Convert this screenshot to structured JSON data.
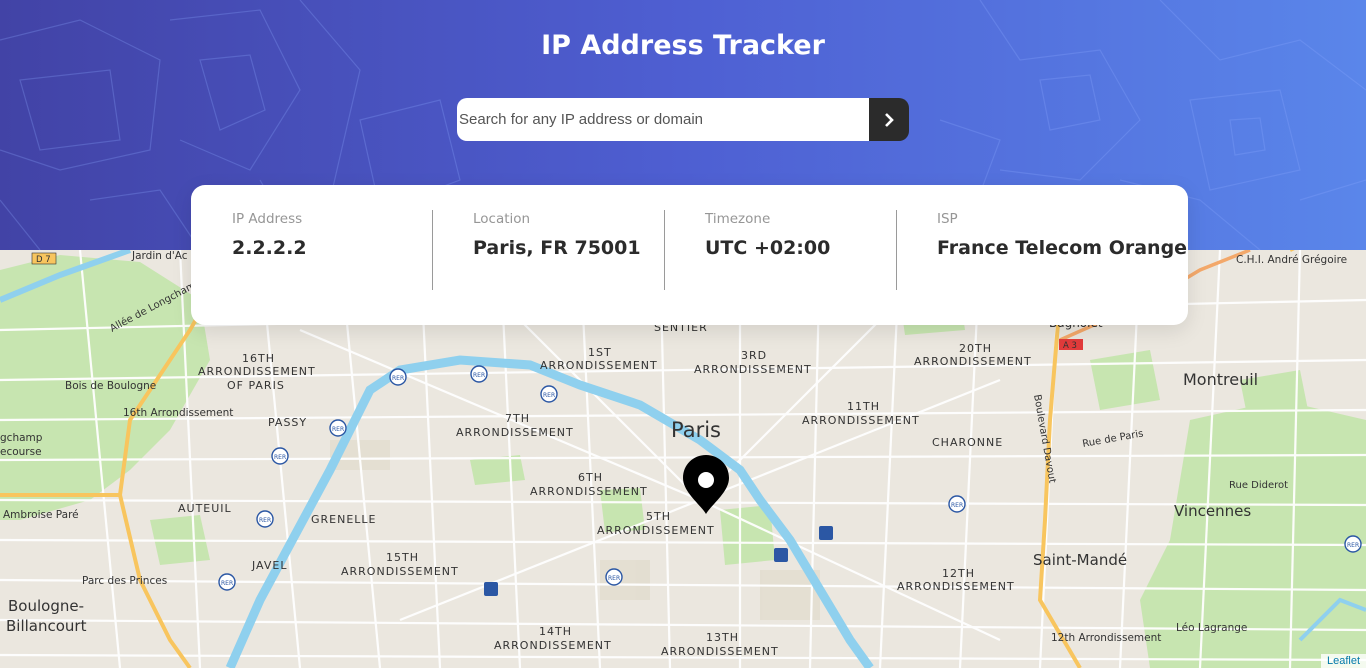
{
  "header": {
    "title": "IP Address Tracker",
    "search_placeholder": "Search for any IP address or domain",
    "search_value": "",
    "gradient_start": "#4243a6",
    "gradient_end": "#5a86ea",
    "button_icon": "chevron-right-icon"
  },
  "info": {
    "ip": {
      "label": "IP Address",
      "value": "2.2.2.2"
    },
    "location": {
      "label": "Location",
      "value": "Paris, FR 75001"
    },
    "timezone": {
      "label": "Timezone",
      "value": "UTC +02:00"
    },
    "isp": {
      "label": "ISP",
      "value": "France Telecom Orange"
    }
  },
  "map": {
    "marker_icon": "location-pin-icon",
    "attribution": "Leaflet",
    "labels": {
      "paris": "Paris",
      "montreuil": "Montreuil",
      "vincennes": "Vincennes",
      "saint_mande": "Saint-Mandé",
      "boulogne_1": "Boulogne-",
      "boulogne_2": "Billancourt",
      "bois_de_boulogne": "Bois de Boulogne",
      "arr16": "16th Arrondissement",
      "arr16_a": "16TH",
      "arr16_b": "ARRONDISSEMENT",
      "arr16_c": "OF PARIS",
      "passy": "PASSY",
      "auteuil": "AUTEUIL",
      "grenelle": "GRENELLE",
      "javel": "JAVEL",
      "arr15_a": "15TH",
      "arr15_b": "ARRONDISSEMENT",
      "arr7_a": "7TH",
      "arr7_b": "ARRONDISSEMENT",
      "arr6_a": "6TH",
      "arr6_b": "ARRONDISSEMENT",
      "arr5_a": "5TH",
      "arr5_b": "ARRONDISSEMENT",
      "arr14_a": "14TH",
      "arr14_b": "ARRONDISSEMENT",
      "arr13_a": "13TH",
      "arr13_b": "ARRONDISSEMENT",
      "arr1_a": "1ST",
      "arr1_b": "ARRONDISSEMENT",
      "arr3_a": "3RD",
      "arr3_b": "ARRONDISSEMENT",
      "arr11_a": "11TH",
      "arr11_b": "ARRONDISSEMENT",
      "arr20_a": "20TH",
      "arr20_b": "ARRONDISSEMENT",
      "arr12_a": "12TH",
      "arr12_b": "ARRONDISSEMENT",
      "arr12_park": "12th Arrondissement",
      "charonne": "CHARONNE",
      "sentier": "SENTIER",
      "parc_princes": "Parc des Princes",
      "ambroise": "Ambroise Paré",
      "longchamp_1": "gchamp",
      "longchamp_2": "ecourse",
      "allee": "Allée de Longchamp",
      "jardin": "Jardin d'Ac",
      "d7": "D 7",
      "a3": "A 3",
      "chi": "C.H.I. André Grégoire",
      "bagnolet": "Bagnolet",
      "bd_davout": "Boulevard Davout",
      "rue_paris": "Rue de Paris",
      "rue_diderot": "Rue Diderot",
      "leo": "Léo Lagrange",
      "rer": "RER"
    }
  }
}
